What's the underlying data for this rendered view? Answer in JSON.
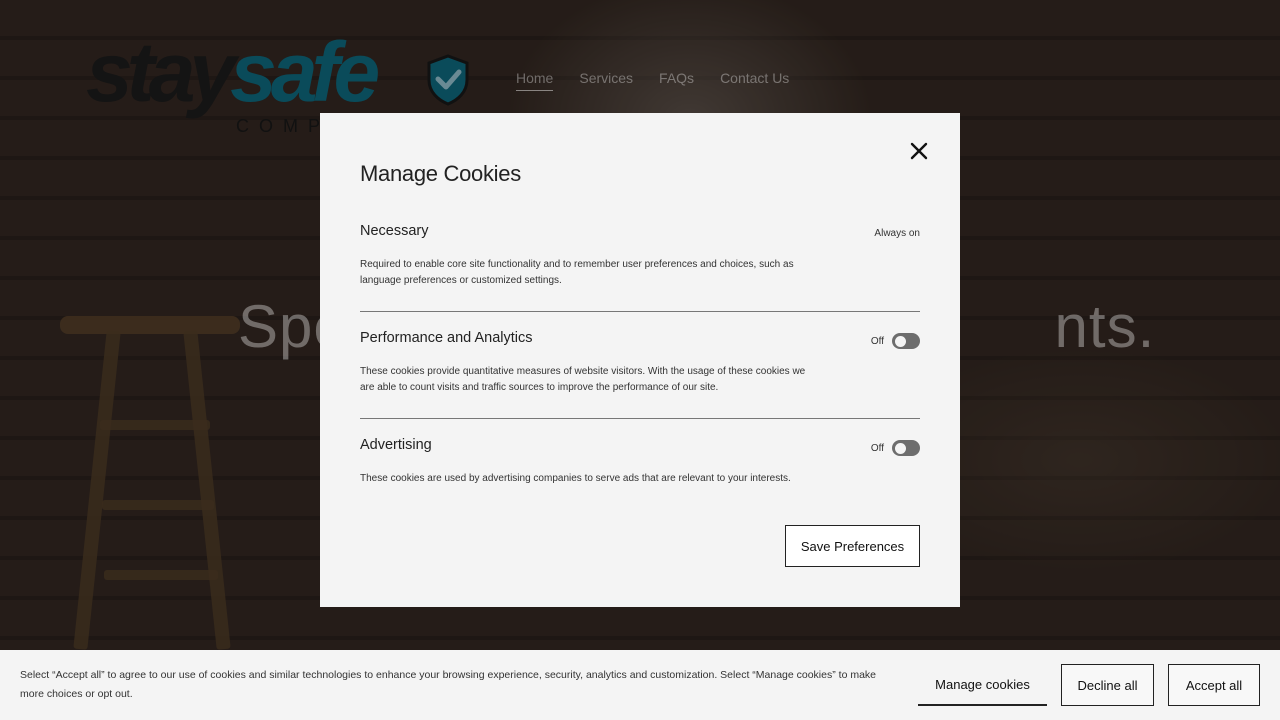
{
  "site": {
    "logo_text_1": "stay",
    "logo_text_2": "safe",
    "logo_subtext": "COMP",
    "nav": [
      "Home",
      "Services",
      "FAQs",
      "Contact Us"
    ],
    "active_nav": "Home",
    "hero_heading": "Spe                                        nts."
  },
  "modal": {
    "title": "Manage Cookies",
    "close_icon": "close-icon",
    "sections": [
      {
        "title": "Necessary",
        "status": "Always on",
        "description": "Required to enable core site functionality and to remember user preferences and choices, such as language preferences or customized settings."
      },
      {
        "title": "Performance and Analytics",
        "toggle_label": "Off",
        "toggle_on": false,
        "description": "These cookies provide quantitative measures of website visitors. With the usage of these cookies we are able to count visits and traffic sources to improve the performance of our site."
      },
      {
        "title": "Advertising",
        "toggle_label": "Off",
        "toggle_on": false,
        "description": "These cookies are used by advertising companies to serve ads that are relevant to your interests."
      }
    ],
    "save_label": "Save Preferences"
  },
  "cookie_bar": {
    "text": "Select “Accept all” to agree to our use of cookies and similar technologies to enhance your browsing experience, security, analytics and customization. Select “Manage cookies” to make more choices or opt out.",
    "manage_label": "Manage cookies",
    "decline_label": "Decline all",
    "accept_label": "Accept all"
  },
  "colors": {
    "modal_bg": "#f4f4f4",
    "toggle_off": "#6d6d6d",
    "logo_accent": "#0a4b5a"
  }
}
